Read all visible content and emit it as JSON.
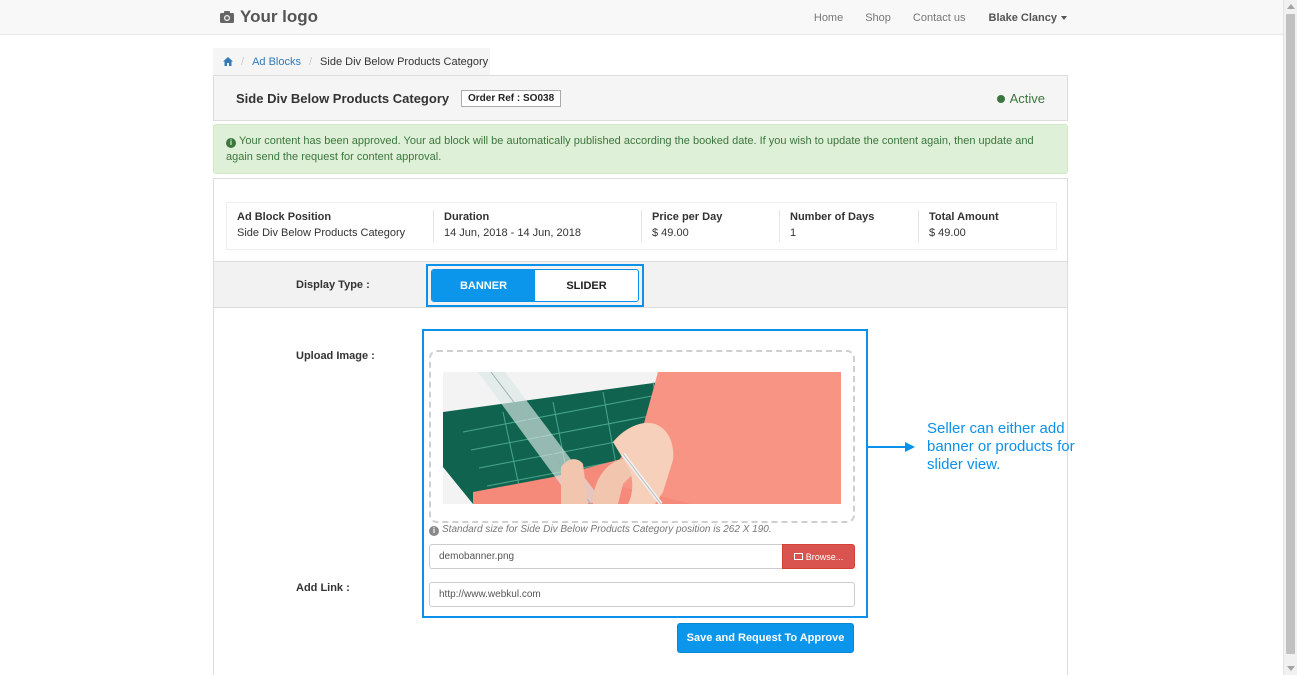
{
  "navbar": {
    "logo_text": "Your logo",
    "links": [
      "Home",
      "Shop",
      "Contact us"
    ],
    "user_name": "Blake Clancy"
  },
  "breadcrumb": {
    "home_icon": "home-icon",
    "items": [
      "Ad Blocks",
      "Side Div Below Products Category"
    ]
  },
  "panel": {
    "title": "Side Div Below Products Category",
    "order_ref": "Order Ref : SO038",
    "status": "Active",
    "status_color": "#3c763d"
  },
  "alert": {
    "message": "Your content has been approved. Your ad block will be automatically published according the booked date. If you wish to update the content again, then update and again send the request for content approval."
  },
  "summary": {
    "columns": [
      {
        "label": "Ad Block Position",
        "value": "Side Div Below Products Category"
      },
      {
        "label": "Duration",
        "value": "14 Jun, 2018 - 14 Jun, 2018"
      },
      {
        "label": "Price per Day",
        "value": "$ 49.00"
      },
      {
        "label": "Number of Days",
        "value": "1"
      },
      {
        "label": "Total Amount",
        "value": "$ 49.00"
      }
    ]
  },
  "form": {
    "display_type_label": "Display Type :",
    "display_type_options": [
      "BANNER",
      "SLIDER"
    ],
    "display_type_selected": "BANNER",
    "upload_image_label": "Upload Image :",
    "size_hint": "Standard size for Side Div Below Products Category position is 262 X 190.",
    "file_name": "demobanner.png",
    "browse_label": "Browse...",
    "add_link_label": "Add Link :",
    "link_value": "http://www.webkul.com",
    "submit_label": "Save and Request To Approve"
  },
  "annotation": {
    "text": "Seller can either add banner or products for slider view."
  },
  "colors": {
    "accent": "#0b96ec",
    "danger": "#d9534f",
    "success_bg": "#dff0d8"
  }
}
